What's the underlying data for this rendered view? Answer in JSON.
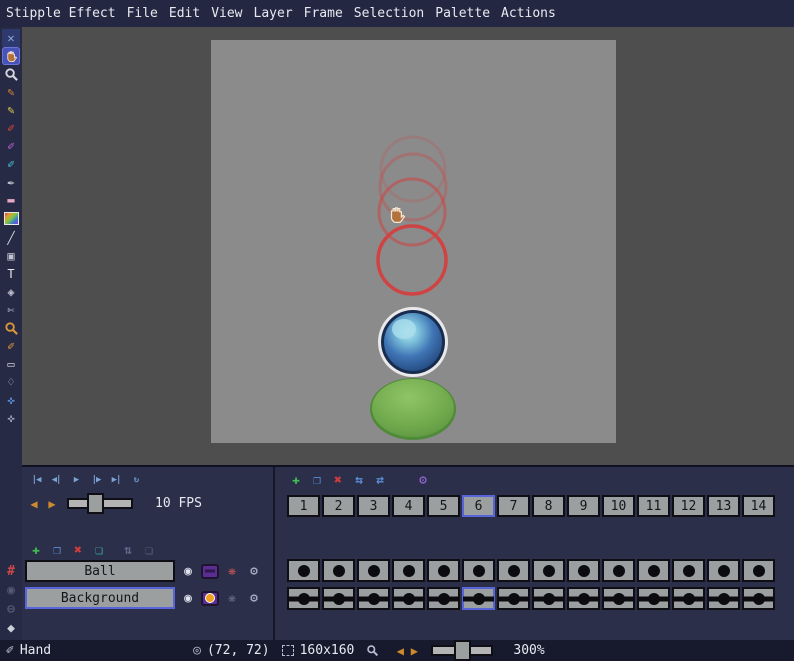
{
  "colors": {
    "accent": "#5765d8",
    "playback_blue": "#7ba3d4",
    "onion_on": "#c85858",
    "onion_off": "#6a6e88"
  },
  "menu": {
    "items": [
      "Stipple Effect",
      "File",
      "Edit",
      "View",
      "Layer",
      "Frame",
      "Selection",
      "Palette",
      "Actions"
    ]
  },
  "toolbar": {
    "tools": [
      {
        "name": "fit-canvas-tool",
        "glyph": "✕",
        "color": "#8fa8e0",
        "bg": "#2e3a6e"
      },
      {
        "name": "hand-tool",
        "svg": "i-hand",
        "selected": true
      },
      {
        "name": "zoom-tool",
        "svg": "i-mag",
        "color": "#d4d7e0"
      },
      {
        "name": "stipple-pencil-tool",
        "glyph": "✎",
        "color": "#d8813a"
      },
      {
        "name": "pencil-tool",
        "glyph": "✎",
        "color": "#d8c84a"
      },
      {
        "name": "brush-tool",
        "glyph": "✐",
        "color": "#cc4838"
      },
      {
        "name": "color-brush-tool",
        "glyph": "✐",
        "color": "#b05fc8"
      },
      {
        "name": "rainbow-brush-tool",
        "glyph": "✐",
        "color": "#48b8d0"
      },
      {
        "name": "script-brush-tool",
        "glyph": "✒",
        "color": "#b8bcc8"
      },
      {
        "name": "eraser-tool",
        "glyph": "▬",
        "color": "#e8a8c4"
      },
      {
        "name": "palette-picker-tool",
        "grad": true
      },
      {
        "name": "line-tool",
        "glyph": "╱",
        "color": "#d0d3dc"
      },
      {
        "name": "shape-tool",
        "glyph": "▣",
        "color": "#c0c4d0"
      },
      {
        "name": "text-tool",
        "glyph": "T",
        "color": "#e4e6ec"
      },
      {
        "name": "fill-tool",
        "glyph": "◈",
        "color": "#c0c4d0"
      },
      {
        "name": "knife-tool",
        "glyph": "✄",
        "color": "#c0c4d0"
      },
      {
        "name": "color-picker-tool",
        "svg": "i-mag",
        "color": "#d8953a"
      },
      {
        "name": "detail-brush-tool",
        "glyph": "✐",
        "color": "#d8953a"
      },
      {
        "name": "marquee-select-tool",
        "glyph": "▭",
        "color": "#c8ccd8"
      },
      {
        "name": "lasso-select-tool",
        "glyph": "♢",
        "color": "#c8ccd8"
      },
      {
        "name": "move-canvas-tool",
        "glyph": "✜",
        "color": "#5b8dd4"
      },
      {
        "name": "pan-tool",
        "glyph": "✜",
        "color": "#9aa0b4"
      }
    ]
  },
  "sidebar_bottom": {
    "icons": [
      {
        "name": "pixel-grid-icon",
        "glyph": "#",
        "color": "#d04848"
      },
      {
        "name": "guide-eye-icon",
        "glyph": "◉",
        "color": "#565a74"
      },
      {
        "name": "guide-eye-off-icon",
        "glyph": "⊖",
        "color": "#565a74"
      },
      {
        "name": "gem-icon",
        "glyph": "◆",
        "color": "#ccd2dc"
      }
    ]
  },
  "playback": {
    "buttons": [
      {
        "name": "first-frame-button",
        "glyph": "|◀",
        "color": "#7ba3d4"
      },
      {
        "name": "prev-frame-button",
        "glyph": "◀|",
        "color": "#7ba3d4"
      },
      {
        "name": "play-button",
        "glyph": "▶",
        "color": "#7ba3d4"
      },
      {
        "name": "next-frame-button",
        "glyph": "|▶",
        "color": "#7ba3d4"
      },
      {
        "name": "last-frame-button",
        "glyph": "▶|",
        "color": "#7ba3d4"
      },
      {
        "name": "loop-toggle-button",
        "glyph": "↻",
        "color": "#6b98c8"
      }
    ],
    "prev_glyph": "◀",
    "next_glyph": "▶",
    "fps_label": "10 FPS"
  },
  "frame_tools": [
    {
      "name": "add-frame-button",
      "glyph": "✚",
      "color": "#40bc50"
    },
    {
      "name": "duplicate-frame-button",
      "glyph": "❐",
      "color": "#5b8dd4"
    },
    {
      "name": "delete-frame-button",
      "glyph": "✖",
      "color": "#d23c3c"
    },
    {
      "name": "move-frame-left-button",
      "glyph": "⇆",
      "color": "#5b8dd4"
    },
    {
      "name": "move-frame-right-button",
      "glyph": "⇄",
      "color": "#5b8dd4"
    },
    {
      "name": "frame-settings-button",
      "glyph": "⚙",
      "color": "#9a68d8",
      "gap": true
    }
  ],
  "frames": {
    "labels": [
      "1",
      "2",
      "3",
      "4",
      "5",
      "6",
      "7",
      "8",
      "9",
      "10",
      "11",
      "12",
      "13",
      "14"
    ],
    "selected_index": 5
  },
  "layer_tools": [
    {
      "name": "add-layer-button",
      "glyph": "✚",
      "color": "#40bc50"
    },
    {
      "name": "duplicate-layer-button",
      "glyph": "❐",
      "color": "#5b8dd4"
    },
    {
      "name": "delete-layer-button",
      "glyph": "✖",
      "color": "#d23c3c"
    },
    {
      "name": "merge-layer-button",
      "glyph": "❏",
      "color": "#3ab0a8"
    },
    {
      "name": "move-layer-button",
      "glyph": "⇅",
      "color": "#60648a",
      "gap": true
    },
    {
      "name": "flatten-layer-button",
      "glyph": "❏",
      "color": "#60648a"
    }
  ],
  "layers": {
    "items": [
      {
        "name": "Ball",
        "selected": false,
        "eye_glyph": "◉",
        "onion_glyph": "❋",
        "gear_glyph": "⚙",
        "link_on": false,
        "onion_on": true
      },
      {
        "name": "Background",
        "selected": true,
        "eye_glyph": "◉",
        "onion_glyph": "❋",
        "gear_glyph": "⚙",
        "link_on": true,
        "onion_on": false
      }
    ]
  },
  "timeline": {
    "rows": [
      {
        "layer": "Ball",
        "linked": false,
        "count": 14,
        "selected_index": -1
      },
      {
        "layer": "Background",
        "linked": true,
        "count": 14,
        "selected_index": 5
      }
    ]
  },
  "status": {
    "tool_icon_glyph": "✐",
    "tool_label": "Hand",
    "coords_icon_glyph": "◎",
    "coords_label": "(72, 72)",
    "size_label": "160x160",
    "prev_glyph": "◀",
    "next_glyph": "▶",
    "zoom_label": "300%"
  }
}
